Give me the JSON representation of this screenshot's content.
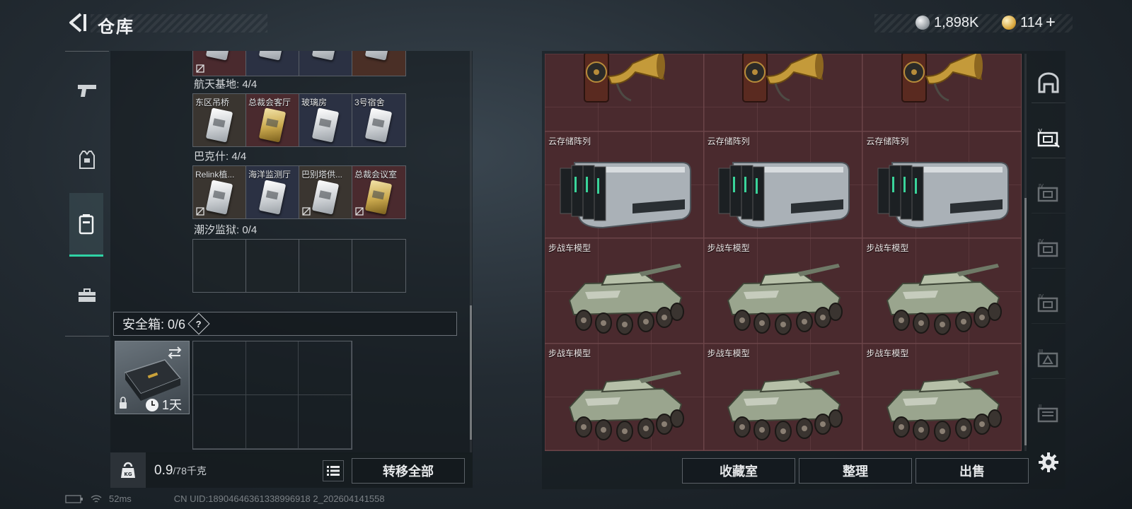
{
  "header": {
    "title": "仓库",
    "currency_a": "1,898K",
    "currency_b": "114",
    "add_symbol": "+"
  },
  "left_panel": {
    "zones": [
      {
        "label": "航天基地: 4/4",
        "cards": [
          {
            "name": "东区吊桥",
            "style": "silver"
          },
          {
            "name": "总裁会客厅",
            "style": "gold"
          },
          {
            "name": "玻璃房",
            "style": "silver"
          },
          {
            "name": "3号宿舍",
            "style": "silver"
          }
        ]
      },
      {
        "label": "巴克什: 4/4",
        "cards": [
          {
            "name": "Relink植...",
            "style": "silver"
          },
          {
            "name": "海洋监测厅",
            "style": "silver"
          },
          {
            "name": "巴别塔供...",
            "style": "silver"
          },
          {
            "name": "总裁会议室",
            "style": "gold"
          }
        ]
      },
      {
        "label": "潮汐监狱: 0/4",
        "cards": []
      }
    ],
    "safebox": {
      "label": "安全箱: 0/6",
      "help": "?",
      "timer": "1天"
    },
    "weight": {
      "current": "0.9",
      "max": "/78千克"
    },
    "transfer_all": "转移全部"
  },
  "right_panel": {
    "items": [
      {
        "name": "",
        "kind": "gramophone"
      },
      {
        "name": "",
        "kind": "gramophone"
      },
      {
        "name": "",
        "kind": "gramophone"
      },
      {
        "name": "云存储阵列",
        "kind": "server"
      },
      {
        "name": "云存储阵列",
        "kind": "server"
      },
      {
        "name": "云存储阵列",
        "kind": "server"
      },
      {
        "name": "步战车模型",
        "kind": "ifv"
      },
      {
        "name": "步战车模型",
        "kind": "ifv"
      },
      {
        "name": "步战车模型",
        "kind": "ifv"
      },
      {
        "name": "步战车模型",
        "kind": "ifv"
      },
      {
        "name": "步战车模型",
        "kind": "ifv"
      },
      {
        "name": "步战车模型",
        "kind": "ifv"
      }
    ],
    "buttons": {
      "collection": "收藏室",
      "sort": "整理",
      "sell": "出售"
    }
  },
  "status": {
    "ping": "52ms",
    "uid": "CN UID:18904646361338996918 2_202604141558"
  },
  "colors": {
    "accent": "#2fd3a5",
    "item_bg": "#4a2a2e"
  }
}
